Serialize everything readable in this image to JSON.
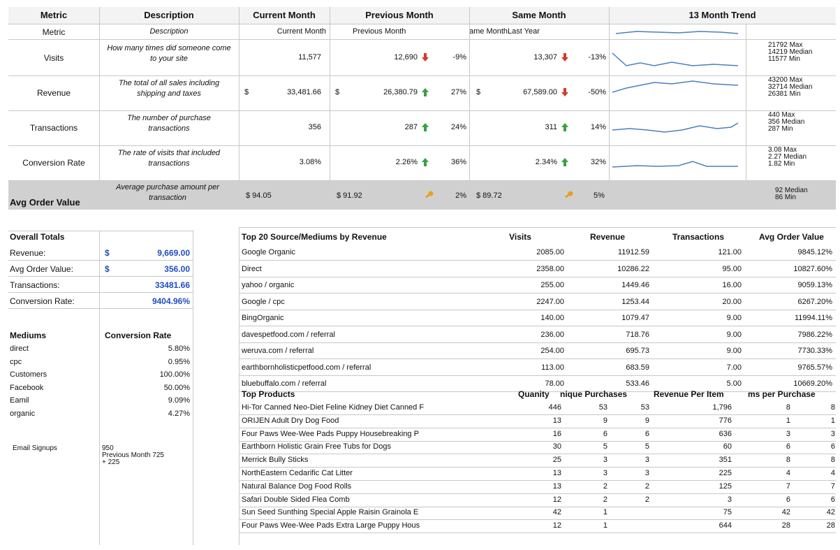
{
  "headers": {
    "metric": "Metric",
    "description": "Description",
    "current": "Current Month",
    "previous": "Previous Month",
    "same": "Same Month",
    "trend": "13 Month Trend"
  },
  "subheaders": {
    "metric": "Metric",
    "description": "Description",
    "current": "Current Month",
    "previous": "Previous Month",
    "same": "ame MonthLast Year"
  },
  "metrics": [
    {
      "name": "Visits",
      "desc": "How many times did someone come to your site",
      "current": "11,577",
      "prev": "12,690",
      "prev_dir": "down",
      "prev_pct": "-9%",
      "same": "13,307",
      "same_dir": "down",
      "same_pct": "-13%",
      "stats": "21792 Max\n14219 Median\n11577 Min"
    },
    {
      "name": "Revenue",
      "desc": "The total of all sales including shipping and taxes",
      "cur_sym": "$",
      "current": "33,481.66",
      "prev_sym": "$",
      "prev": "26,380.79",
      "prev_dir": "up",
      "prev_pct": "27%",
      "same_sym": "$",
      "same": "67,589.00",
      "same_dir": "down",
      "same_pct": "-50%",
      "stats": "43200 Max\n32714 Median\n26381 Min"
    },
    {
      "name": "Transactions",
      "desc": "The number of purchase transactions",
      "current": "356",
      "prev": "287",
      "prev_dir": "up",
      "prev_pct": "24%",
      "same": "311",
      "same_dir": "up",
      "same_pct": "14%",
      "stats": "440 Max\n356 Median\n287 Min"
    },
    {
      "name": "Conversion Rate",
      "desc": "The rate of visits that included transactions",
      "current": "3.08%",
      "prev": "2.26%",
      "prev_dir": "up",
      "prev_pct": "36%",
      "same": "2.34%",
      "same_dir": "up",
      "same_pct": "32%",
      "stats": "3.08 Max\n2.27 Median\n1.82 Min"
    }
  ],
  "aov": {
    "name": "Avg Order Value",
    "desc": "Average purchase amount per transaction",
    "current": "$ 94.05",
    "prev": "$ 91.92",
    "prev_pct": "2%",
    "same": "$ 89.72",
    "same_pct": "5%",
    "stats": "92 Median\n86 Min"
  },
  "overall": {
    "title": "Overall Totals",
    "rows": [
      {
        "label": "Revenue:",
        "sym": "$",
        "value": "9,669.00"
      },
      {
        "label": "Avg Order Value:",
        "sym": "$",
        "value": "356.00"
      },
      {
        "label": "Transactions:",
        "sym": "",
        "value": "33481.66"
      },
      {
        "label": "Conversion Rate:",
        "sym": "",
        "value": "9404.96%"
      }
    ]
  },
  "mediums": {
    "h1": "Mediums",
    "h2": "Conversion Rate",
    "rows": [
      {
        "name": "direct",
        "rate": "5.80%"
      },
      {
        "name": "cpc",
        "rate": "0.95%"
      },
      {
        "name": "Customers",
        "rate": "100.00%"
      },
      {
        "name": "Facebook",
        "rate": "50.00%"
      },
      {
        "name": "Eamil",
        "rate": "9.09%"
      },
      {
        "name": "organic",
        "rate": "4.27%"
      }
    ]
  },
  "email": {
    "label": "Email Signups",
    "value": "950",
    "note1": "Previous Month 725",
    "note2": "+ 225"
  },
  "sources": {
    "headers": [
      "Top 20 Source/Mediums by Revenue",
      "Visits",
      "Revenue",
      "Transactions",
      "Avg Order Value"
    ],
    "rows": [
      [
        "Google Organic",
        "2085.00",
        "11912.59",
        "121.00",
        "9845.12%"
      ],
      [
        "Direct",
        "2358.00",
        "10286.22",
        "95.00",
        "10827.60%"
      ],
      [
        "yahoo / organic",
        "255.00",
        "1449.46",
        "16.00",
        "9059.13%"
      ],
      [
        "Google / cpc",
        "2247.00",
        "1253.44",
        "20.00",
        "6267.20%"
      ],
      [
        "BingOrganic",
        "140.00",
        "1079.47",
        "9.00",
        "11994.11%"
      ],
      [
        "davespetfood.com / referral",
        "236.00",
        "718.76",
        "9.00",
        "7986.22%"
      ],
      [
        "weruva.com / referral",
        "254.00",
        "695.73",
        "9.00",
        "7730.33%"
      ],
      [
        "earthbornholisticpetfood.com / referral",
        "113.00",
        "683.59",
        "7.00",
        "9765.57%"
      ],
      [
        "bluebuffalo.com / referral",
        "78.00",
        "533.46",
        "5.00",
        "10669.20%"
      ]
    ]
  },
  "products": {
    "headers": [
      "Top Products",
      "Quanity",
      "Unique Purchases",
      "Revenue Per Item",
      "Items per Purchase"
    ],
    "header_display": [
      "Top Products",
      "Quanity",
      "nique Purchases",
      "Revenue Per Item",
      "ms per Purchase"
    ],
    "rows": [
      [
        "Hi-Tor Canned Neo-Diet Feline Kidney Diet Canned F",
        "446",
        "53",
        "53",
        "1,796",
        "8",
        "8"
      ],
      [
        "ORIJEN Adult Dry Dog Food",
        "13",
        "9",
        "9",
        "776",
        "1",
        "1"
      ],
      [
        "Four Paws Wee-Wee Pads Puppy Housebreaking P",
        "16",
        "6",
        "6",
        "636",
        "3",
        "3"
      ],
      [
        "Earthborn Holistic Grain Free Tubs for Dogs",
        "30",
        "5",
        "5",
        "60",
        "6",
        "6"
      ],
      [
        "Merrick Bully Sticks",
        "25",
        "3",
        "3",
        "351",
        "8",
        "8"
      ],
      [
        "NorthEastern Cedarific Cat Litter",
        "13",
        "3",
        "3",
        "225",
        "4",
        "4"
      ],
      [
        "Natural Balance Dog Food Rolls",
        "13",
        "2",
        "2",
        "125",
        "7",
        "7"
      ],
      [
        "Safari Double Sided Flea Comb",
        "12",
        "2",
        "2",
        "3",
        "6",
        "6"
      ],
      [
        "Sun Seed Sunthing Special Apple Raisin Grainola E",
        "42",
        "1",
        "",
        "75",
        "42",
        "42"
      ],
      [
        "Four Paws Wee-Wee Pads Extra Large Puppy Hous",
        "12",
        "1",
        "",
        "644",
        "28",
        "28"
      ]
    ]
  },
  "colors": {
    "spark": "#4a7fbf",
    "up": "#3aa040",
    "down": "#d63a2a",
    "side": "#e8a020",
    "aov_bg": "#d0d0d0",
    "blue": "#1f4fbf"
  }
}
